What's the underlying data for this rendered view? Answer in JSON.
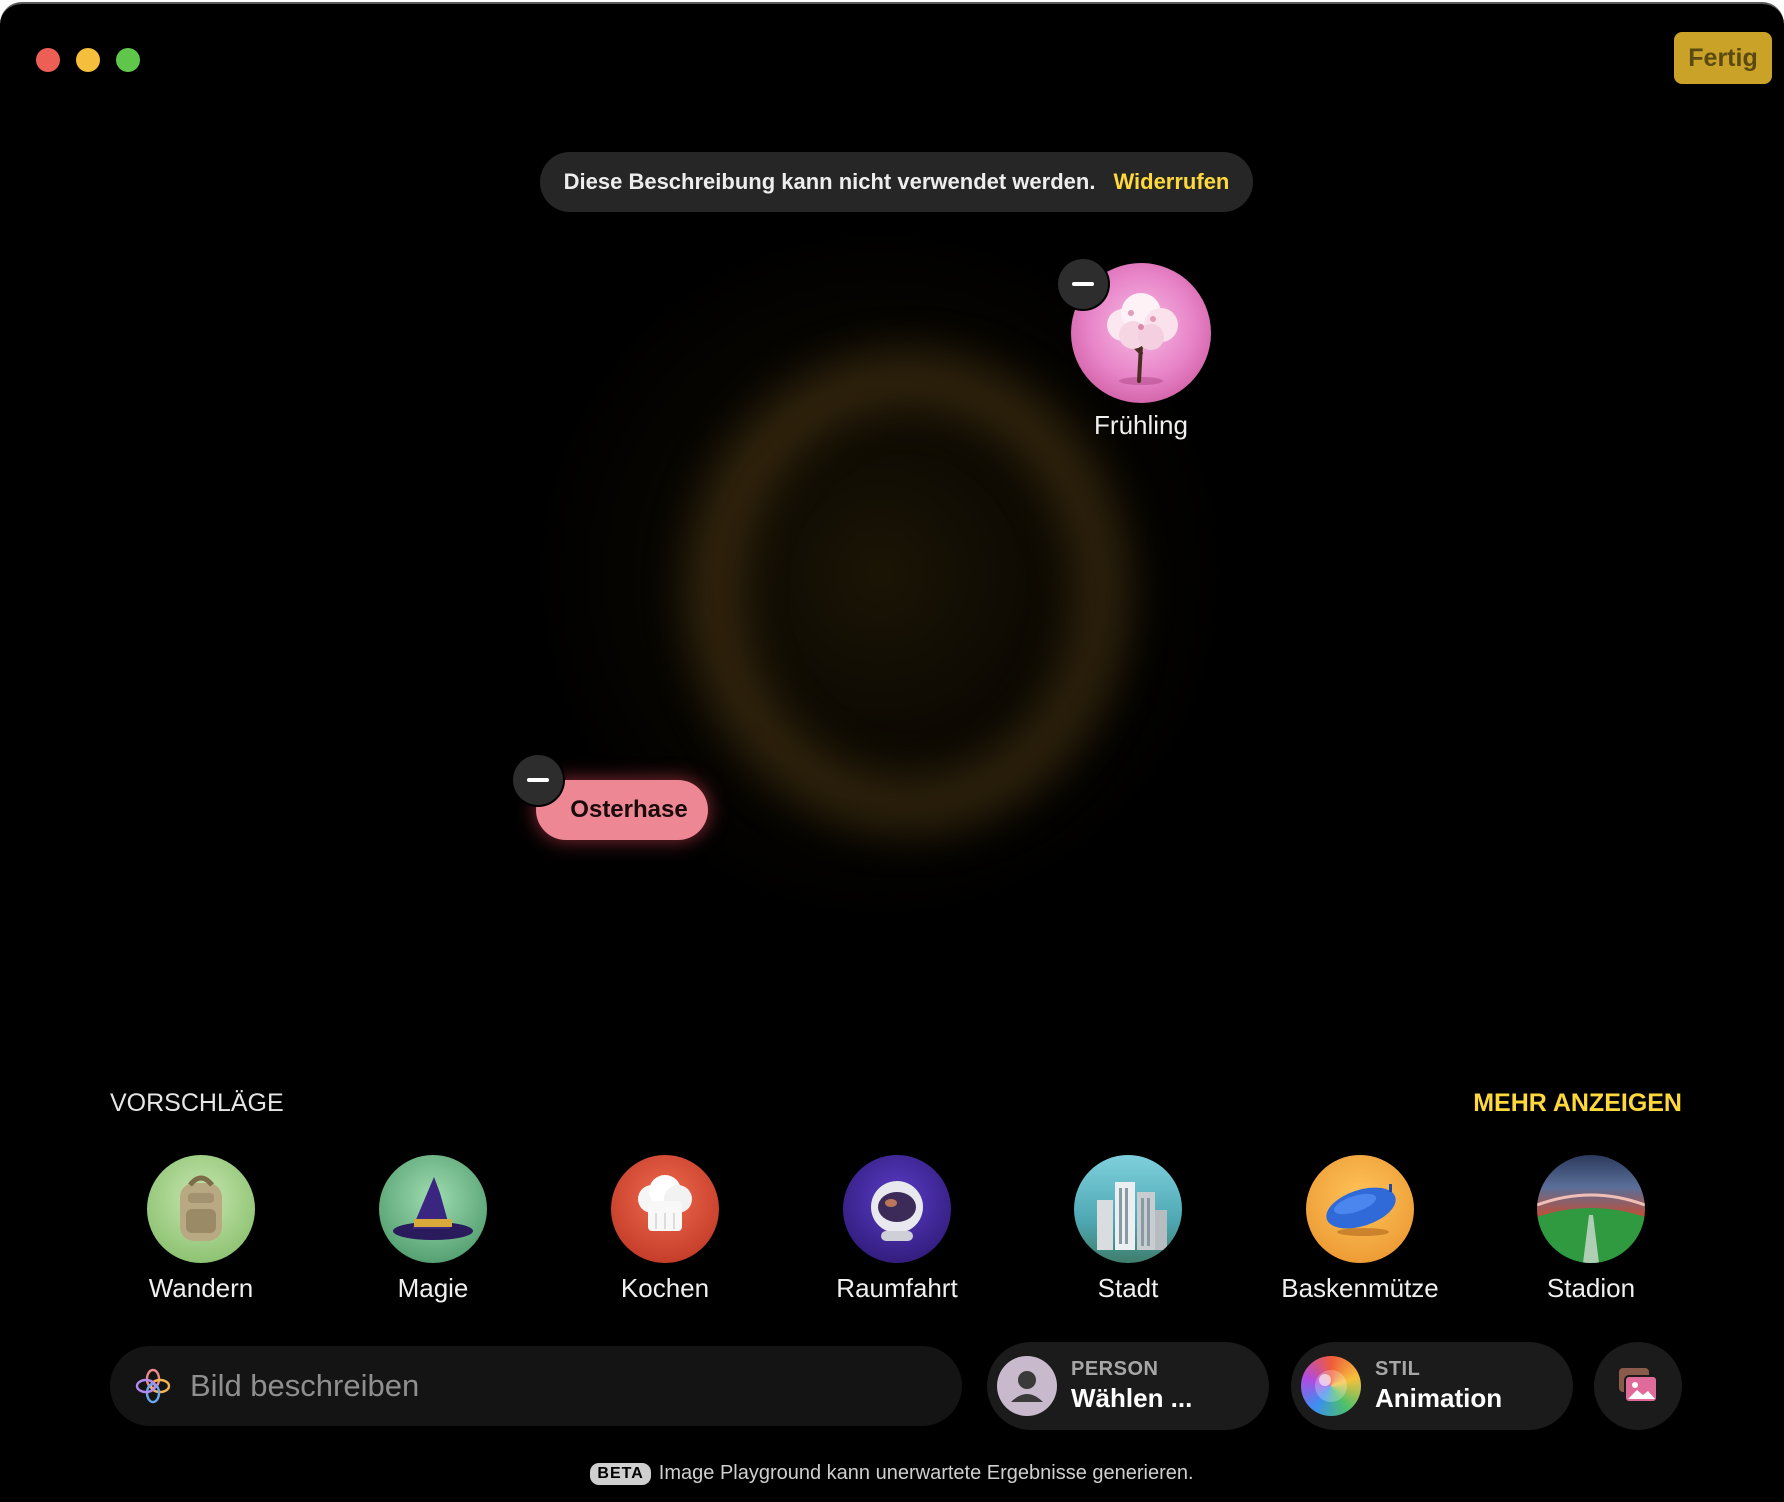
{
  "window": {
    "done_label": "Fertig"
  },
  "toast": {
    "message": "Diese Beschreibung kann nicht verwendet werden.",
    "action": "Widerrufen"
  },
  "canvas": {
    "concepts": [
      {
        "label": "Frühling",
        "kind": "image",
        "icon": "cherry-blossom-tree-icon"
      },
      {
        "label": "Osterhase",
        "kind": "text-pill"
      }
    ]
  },
  "suggestions": {
    "title": "VORSCHLÄGE",
    "more": "MEHR ANZEIGEN",
    "items": [
      {
        "label": "Wandern",
        "icon": "backpack-icon"
      },
      {
        "label": "Magie",
        "icon": "wizard-hat-icon"
      },
      {
        "label": "Kochen",
        "icon": "chef-hat-icon"
      },
      {
        "label": "Raumfahrt",
        "icon": "astronaut-helmet-icon"
      },
      {
        "label": "Stadt",
        "icon": "skyscrapers-icon"
      },
      {
        "label": "Baskenmütze",
        "icon": "beret-icon"
      },
      {
        "label": "Stadion",
        "icon": "stadium-icon"
      }
    ]
  },
  "prompt": {
    "placeholder": "Bild beschreiben"
  },
  "person": {
    "caption": "PERSON",
    "value": "Wählen ..."
  },
  "style": {
    "caption": "STIL",
    "value": "Animation"
  },
  "footer": {
    "badge": "BETA",
    "text": "Image Playground kann unerwartete Ergebnisse generieren."
  },
  "colors": {
    "accent": "#ffd93b",
    "done_button": "#c9a227",
    "pill": "#ec8793",
    "background": "#000000"
  }
}
